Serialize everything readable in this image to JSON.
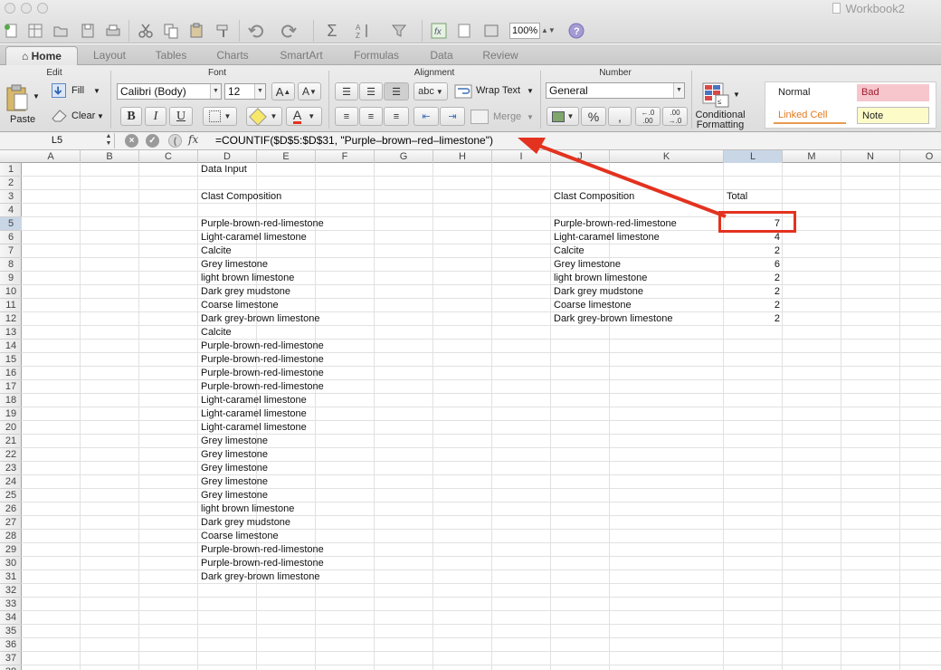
{
  "window": {
    "title": "Workbook2"
  },
  "toolbar": {
    "zoom": "100%"
  },
  "ribbon": {
    "tabs": [
      {
        "label": "Home",
        "active": true
      },
      {
        "label": "Layout"
      },
      {
        "label": "Tables"
      },
      {
        "label": "Charts"
      },
      {
        "label": "SmartArt"
      },
      {
        "label": "Formulas"
      },
      {
        "label": "Data"
      },
      {
        "label": "Review"
      }
    ],
    "groups": {
      "edit": "Edit",
      "font": "Font",
      "alignment": "Alignment",
      "number": "Number"
    },
    "edit": {
      "paste": "Paste",
      "fill": "Fill",
      "clear": "Clear"
    },
    "font": {
      "name": "Calibri (Body)",
      "size": "12",
      "bold": "B",
      "italic": "I",
      "underline": "U",
      "grow": "A",
      "shrink": "A",
      "color": "A",
      "color_hex": "#e3321f"
    },
    "alignment": {
      "orientation": "abc",
      "wrap": "Wrap Text",
      "merge": "Merge"
    },
    "number": {
      "format": "General",
      "percent": "%",
      "comma": ",",
      "dec_inc": "←.0 .00",
      "dec_dec": ".00 →.0",
      "conditional_line1": "Conditional",
      "conditional_line2": "Formatting"
    },
    "styles": {
      "normal": "Normal",
      "bad": "Bad",
      "linked_cell": "Linked Cell",
      "note": "Note"
    }
  },
  "formula_bar": {
    "name_box": "L5",
    "fx": "fx",
    "formula": "=COUNTIF($D$5:$D$31, \"Purple–brown–red–limestone\")"
  },
  "sheet": {
    "columns": [
      "A",
      "B",
      "C",
      "D",
      "E",
      "F",
      "G",
      "H",
      "I",
      "J",
      "K",
      "L",
      "M",
      "N",
      "O"
    ],
    "selected_column": "L",
    "selected_row": 5,
    "row_count": 38,
    "data_input_title": "Data Input",
    "clast_header_d": "Clast Composition",
    "data_input": [
      "Purple-brown-red-limestone",
      "Light-caramel limestone",
      "Calcite",
      "Grey limestone",
      "light brown limestone",
      "Dark grey mudstone",
      "Coarse limestone",
      "Dark grey-brown limestone",
      "Calcite",
      "Purple-brown-red-limestone",
      "Purple-brown-red-limestone",
      "Purple-brown-red-limestone",
      "Purple-brown-red-limestone",
      "Light-caramel limestone",
      "Light-caramel limestone",
      "Light-caramel limestone",
      "Grey limestone",
      "Grey limestone",
      "Grey limestone",
      "Grey limestone",
      "Grey limestone",
      "light brown limestone",
      "Dark grey mudstone",
      "Coarse limestone",
      "Purple-brown-red-limestone",
      "Purple-brown-red-limestone",
      "Dark grey-brown limestone"
    ],
    "summary": {
      "header_j": "Clast Composition",
      "header_l": "Total",
      "rows": [
        {
          "label": "Purple-brown-red-limestone",
          "total": "7"
        },
        {
          "label": "Light-caramel limestone",
          "total": "4"
        },
        {
          "label": "Calcite",
          "total": "2"
        },
        {
          "label": "Grey limestone",
          "total": "6"
        },
        {
          "label": "light brown limestone",
          "total": "2"
        },
        {
          "label": "Dark grey mudstone",
          "total": "2"
        },
        {
          "label": "Coarse limestone",
          "total": "2"
        },
        {
          "label": "Dark grey-brown limestone",
          "total": "2"
        }
      ]
    }
  },
  "annotation": {
    "color": "#e3321f"
  }
}
